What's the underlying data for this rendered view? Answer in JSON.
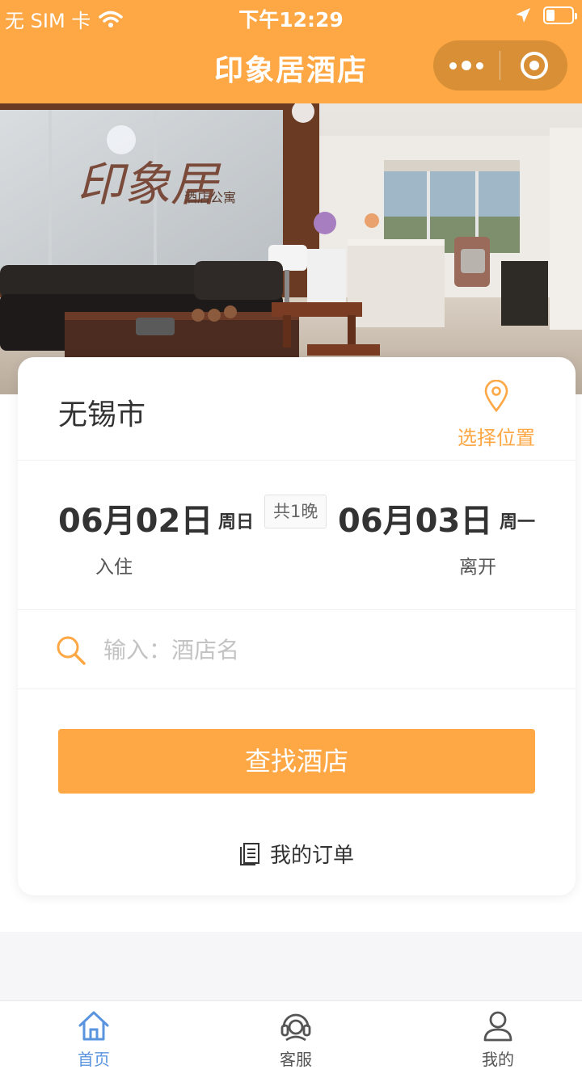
{
  "status_bar": {
    "carrier": "无 SIM 卡",
    "time": "下午12:29"
  },
  "nav": {
    "title": "印象居酒店"
  },
  "banner": {
    "sign_text": "印象居",
    "sign_sub": "酒店公寓"
  },
  "search_card": {
    "city": "无锡市",
    "location_label": "选择位置",
    "checkin_date": "06月02日",
    "checkin_weekday": "周日",
    "nights": "共1晚",
    "checkout_date": "06月03日",
    "checkout_weekday": "周一",
    "checkin_label": "入住",
    "checkout_label": "离开",
    "search_placeholder": "输入：酒店名",
    "search_value": "",
    "search_button": "查找酒店",
    "orders_label": "我的订单"
  },
  "tabbar": {
    "items": [
      {
        "label": "首页",
        "icon": "home-icon",
        "active": true
      },
      {
        "label": "客服",
        "icon": "headset-icon",
        "active": false
      },
      {
        "label": "我的",
        "icon": "user-icon",
        "active": false
      }
    ]
  },
  "colors": {
    "accent": "#fea745",
    "tab_active": "#5a94df"
  }
}
